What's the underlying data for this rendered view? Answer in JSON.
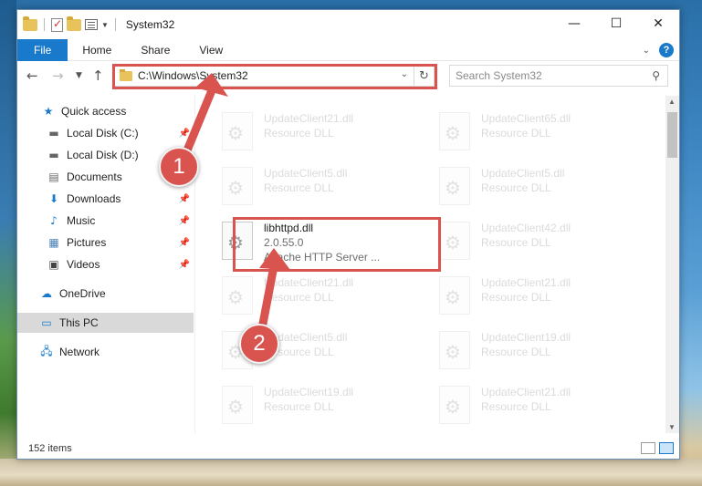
{
  "window": {
    "title": "System32"
  },
  "ribbon": {
    "tabs": [
      "File",
      "Home",
      "Share",
      "View"
    ]
  },
  "address": {
    "path": "C:\\Windows\\System32"
  },
  "search": {
    "placeholder": "Search System32"
  },
  "sidebar": {
    "items": [
      {
        "label": "Quick access",
        "icon": "star-icon"
      },
      {
        "label": "Local Disk (C:)",
        "icon": "drive-icon"
      },
      {
        "label": "Local Disk (D:)",
        "icon": "drive-icon"
      },
      {
        "label": "Documents",
        "icon": "documents-icon"
      },
      {
        "label": "Downloads",
        "icon": "download-icon"
      },
      {
        "label": "Music",
        "icon": "music-icon"
      },
      {
        "label": "Pictures",
        "icon": "pictures-icon"
      },
      {
        "label": "Videos",
        "icon": "videos-icon"
      },
      {
        "label": "OneDrive",
        "icon": "cloud-icon"
      },
      {
        "label": "This PC",
        "icon": "computer-icon"
      },
      {
        "label": "Network",
        "icon": "network-icon"
      }
    ]
  },
  "files": [
    {
      "name": "UpdateClient21.dll",
      "type": "Resource DLL"
    },
    {
      "name": "UpdateClient65.dll",
      "type": "Resource DLL"
    },
    {
      "name": "UpdateClient5.dll",
      "type": "Resource DLL"
    },
    {
      "name": "UpdateClient5.dll",
      "type": "Resource DLL"
    },
    {
      "name": "libhttpd.dll",
      "version": "2.0.55.0",
      "type": "Apache HTTP Server ..."
    },
    {
      "name": "UpdateClient42.dll",
      "type": "Resource DLL"
    },
    {
      "name": "UpdateClient21.dll",
      "type": "Resource DLL"
    },
    {
      "name": "UpdateClient21.dll",
      "type": "Resource DLL"
    },
    {
      "name": "UpdateClient5.dll",
      "type": "Resource DLL"
    },
    {
      "name": "UpdateClient19.dll",
      "type": "Resource DLL"
    },
    {
      "name": "UpdateClient19.dll",
      "type": "Resource DLL"
    },
    {
      "name": "UpdateClient21.dll",
      "type": "Resource DLL"
    }
  ],
  "status": {
    "item_count": "152 items"
  },
  "annotations": {
    "step1": "1",
    "step2": "2",
    "color": "#d9534f"
  }
}
